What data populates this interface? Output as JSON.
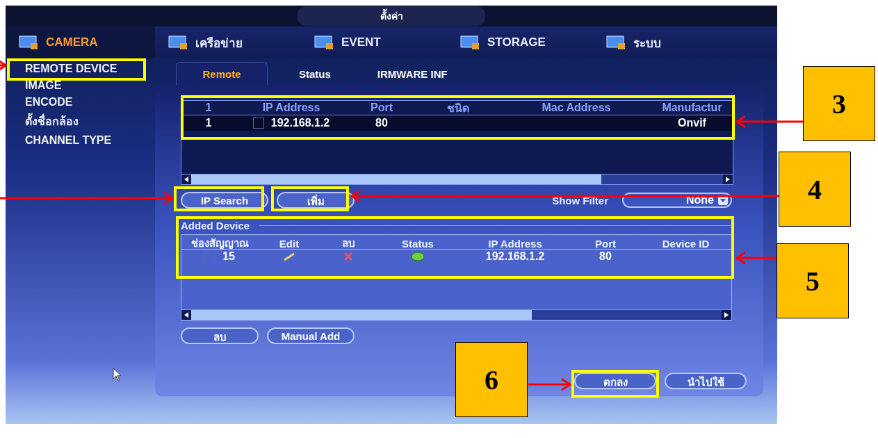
{
  "window": {
    "title": "ตั้งค่า"
  },
  "nav": [
    {
      "label": "CAMERA",
      "selected": true
    },
    {
      "label": "เครือข่าย",
      "selected": false
    },
    {
      "label": "EVENT",
      "selected": false
    },
    {
      "label": "STORAGE",
      "selected": false
    },
    {
      "label": "ระบบ",
      "selected": false
    }
  ],
  "sidebar": {
    "items": [
      "REMOTE DEVICE",
      "IMAGE",
      "ENCODE",
      "ตั้งชื่อกล้อง",
      "CHANNEL TYPE"
    ]
  },
  "subtabs": [
    {
      "label": "Remote",
      "selected": true
    },
    {
      "label": "Status",
      "selected": false
    },
    {
      "label": "IRMWARE INF",
      "selected": false
    }
  ],
  "device_table": {
    "columns": [
      "1",
      "IP Address",
      "Port",
      "ชนิด",
      "Mac Address",
      "Manufactur"
    ],
    "rows": [
      {
        "cells": [
          "1",
          "192.168.1.2",
          "80",
          "",
          "",
          "Onvif"
        ],
        "checked": false
      }
    ]
  },
  "search_buttons": [
    "IP Search",
    "เพิ่ม"
  ],
  "filter": {
    "label": "Show Filter",
    "value": "None"
  },
  "added_device": {
    "title": "Added Device",
    "columns": [
      "ช่องสัญญาณ",
      "Edit",
      "ลบ",
      "Status",
      "IP Address",
      "Port",
      "Device ID"
    ],
    "rows": [
      {
        "channel": "15",
        "checked": false,
        "ip": "192.168.1.2",
        "port": "80",
        "device_id": ""
      }
    ]
  },
  "added_buttons": [
    "ลบ",
    "Manual Add"
  ],
  "footer_buttons": [
    "ตกลง",
    "นำไปใช้"
  ],
  "callouts": [
    "3",
    "4",
    "5",
    "6"
  ]
}
